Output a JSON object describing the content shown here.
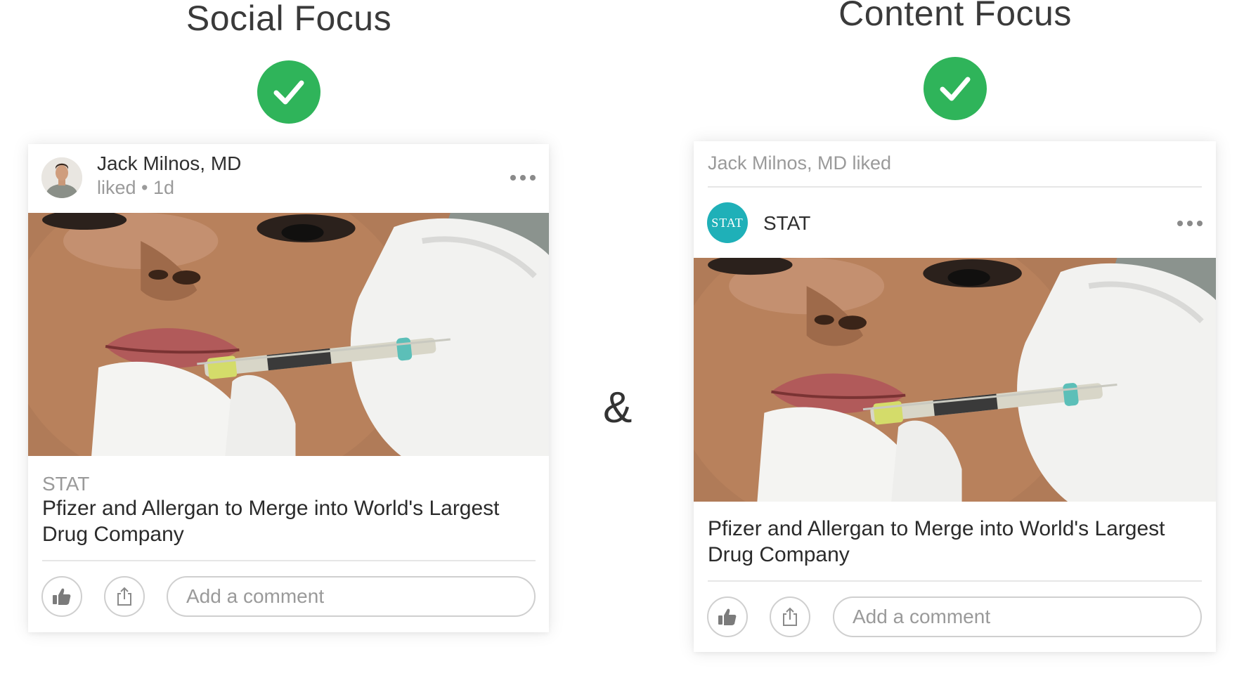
{
  "left": {
    "heading": "Social Focus",
    "card": {
      "author_name": "Jack Milnos, MD",
      "author_meta": "liked • 1d",
      "source": "STAT",
      "headline": "Pfizer and Allergan to Merge into World's Largest Drug Company",
      "comment_placeholder": "Add a comment"
    }
  },
  "separator": "&",
  "right": {
    "heading": "Content Focus",
    "card": {
      "activity": "Jack Milnos, MD liked",
      "logo_text": "STAT",
      "publisher": "STAT",
      "headline": "Pfizer and Allergan to Merge into World's Largest Drug Company",
      "comment_placeholder": "Add a comment"
    }
  },
  "colors": {
    "check_green": "#2fb45a",
    "stat_teal": "#1fb0b8"
  },
  "icons": [
    "check-icon",
    "more-icon",
    "like-icon",
    "share-icon"
  ]
}
